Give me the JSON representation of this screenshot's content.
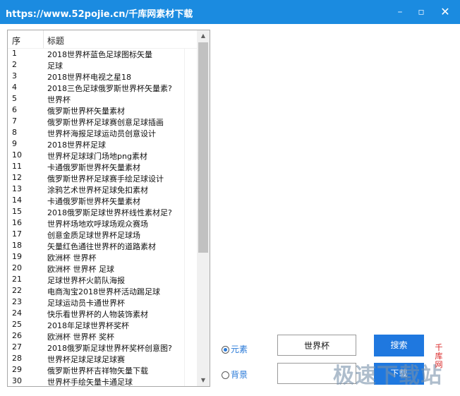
{
  "window": {
    "title": "https://www.52pojie.cn/千库网素材下载",
    "minimize_glyph": "–",
    "maximize_glyph": "▫",
    "close_glyph": "✕"
  },
  "list": {
    "columns": [
      "序",
      "标题"
    ],
    "rows": [
      {
        "n": "1",
        "t": "2018世界杯蓝色足球图标矢量"
      },
      {
        "n": "2",
        "t": "足球"
      },
      {
        "n": "3",
        "t": "2018世界杯电视之星18"
      },
      {
        "n": "4",
        "t": "2018三色足球俄罗斯世界杯矢量素?"
      },
      {
        "n": "5",
        "t": "世界杯"
      },
      {
        "n": "6",
        "t": "俄罗斯世界杯矢量素材"
      },
      {
        "n": "7",
        "t": "俄罗斯世界杯足球赛创意足球插画"
      },
      {
        "n": "8",
        "t": "世界杯海报足球运动员创意设计"
      },
      {
        "n": "9",
        "t": "2018世界杯足球"
      },
      {
        "n": "10",
        "t": "世界杯足球球门场地png素材"
      },
      {
        "n": "11",
        "t": "卡通俄罗斯世界杯矢量素材"
      },
      {
        "n": "12",
        "t": "俄罗斯世界杯足球赛手绘足球设计"
      },
      {
        "n": "13",
        "t": "涂鸦艺术世界杯足球免扣素材"
      },
      {
        "n": "14",
        "t": "卡通俄罗斯世界杯矢量素材"
      },
      {
        "n": "15",
        "t": "2018俄罗斯足球世界杯线性素材足?"
      },
      {
        "n": "16",
        "t": "世界杯场地欢呼球场观众赛场"
      },
      {
        "n": "17",
        "t": "创意金质足球世界杯足球场"
      },
      {
        "n": "18",
        "t": "矢量红色通往世界杯的道路素材"
      },
      {
        "n": "19",
        "t": "欧洲杯 世界杯"
      },
      {
        "n": "20",
        "t": "欧洲杯 世界杯 足球"
      },
      {
        "n": "21",
        "t": "足球世界杯火箭队海报"
      },
      {
        "n": "22",
        "t": "电商淘宝2018世界杯活动踢足球"
      },
      {
        "n": "23",
        "t": "足球运动员卡通世界杯"
      },
      {
        "n": "24",
        "t": "快乐看世界杯的人物装饰素材"
      },
      {
        "n": "25",
        "t": "2018年足球世界杯奖杯"
      },
      {
        "n": "26",
        "t": "欧洲杯 世界杯  奖杯"
      },
      {
        "n": "27",
        "t": "2018俄罗斯足球世界杯奖杯创意图?"
      },
      {
        "n": "28",
        "t": "世界杯足球足球足球赛"
      },
      {
        "n": "29",
        "t": "俄罗斯世界杯吉祥物矢量下载"
      },
      {
        "n": "30",
        "t": "世界杯手绘矢量卡通足球"
      }
    ]
  },
  "scroll": {
    "up_glyph": "▲",
    "down_glyph": "▼"
  },
  "options": {
    "element_label": "元素",
    "background_label": "背景",
    "selected": "元素"
  },
  "search": {
    "value": "世界杯",
    "button_label": "搜索"
  },
  "bg_input": {
    "value": ""
  },
  "download": {
    "button_label": "下载"
  },
  "vertical_label": "千库网",
  "watermark": "极速下载站",
  "colors": {
    "titlebar": "#1b8be0",
    "button": "#1f78df",
    "radio_text": "#2a7ad8",
    "vertical_label": "#d92020"
  }
}
